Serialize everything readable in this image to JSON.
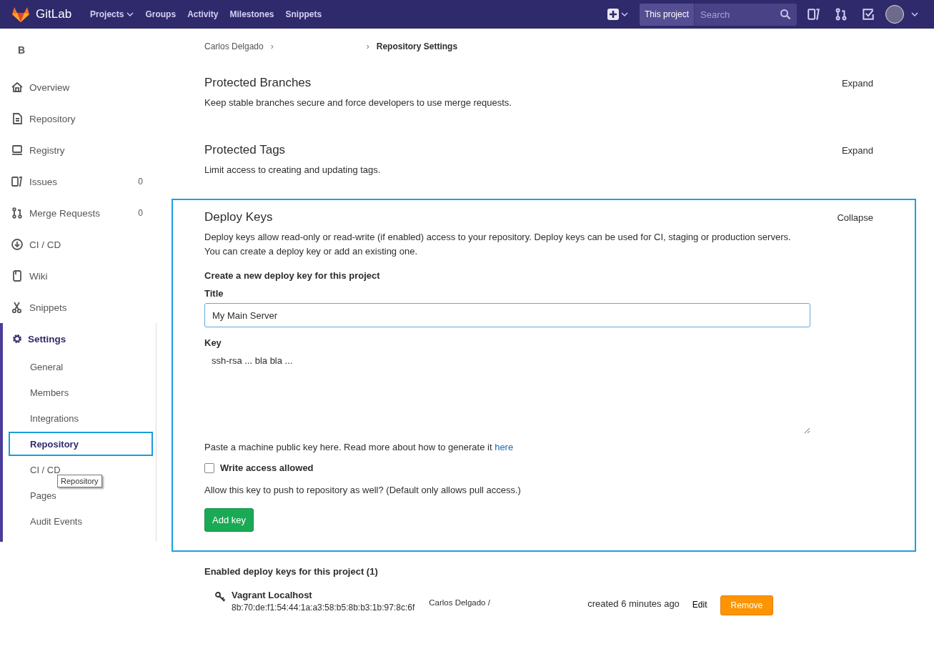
{
  "header": {
    "logo_text": "GitLab",
    "nav": [
      {
        "label": "Projects",
        "has_caret": true
      },
      {
        "label": "Groups",
        "has_caret": false
      },
      {
        "label": "Activity",
        "has_caret": false
      },
      {
        "label": "Milestones",
        "has_caret": false
      },
      {
        "label": "Snippets",
        "has_caret": false
      }
    ],
    "search": {
      "scope": "This project",
      "placeholder": "Search"
    }
  },
  "sidebar": {
    "project_letter": "B",
    "items": [
      {
        "label": "Overview"
      },
      {
        "label": "Repository"
      },
      {
        "label": "Registry"
      },
      {
        "label": "Issues",
        "count": "0"
      },
      {
        "label": "Merge Requests",
        "count": "0"
      },
      {
        "label": "CI / CD"
      },
      {
        "label": "Wiki"
      },
      {
        "label": "Snippets"
      }
    ],
    "settings": {
      "label": "Settings",
      "expanded": true,
      "children": [
        {
          "label": "General",
          "selected": false
        },
        {
          "label": "Members",
          "selected": false
        },
        {
          "label": "Integrations",
          "selected": false
        },
        {
          "label": "Repository",
          "selected": true
        },
        {
          "label": "CI / CD",
          "selected": false
        },
        {
          "label": "Pages",
          "selected": false
        },
        {
          "label": "Audit Events",
          "selected": false
        }
      ]
    },
    "tooltip": "Repository"
  },
  "breadcrumb": {
    "separator": "›",
    "items": [
      "Carlos Delgado",
      "Repository Settings"
    ]
  },
  "sections": [
    {
      "title": "Protected Branches",
      "description": "Keep stable branches secure and force developers to use merge requests.",
      "toggle": "Expand",
      "expanded": false
    },
    {
      "title": "Protected Tags",
      "description": "Limit access to creating and updating tags.",
      "toggle": "Expand",
      "expanded": false
    },
    {
      "title": "Deploy Keys",
      "description": "Deploy keys allow read-only or read-write (if enabled) access to your repository. Deploy keys can be used for CI, staging or production servers. You can create a deploy key or add an existing one.",
      "toggle": "Collapse",
      "expanded": true
    }
  ],
  "deploy_form": {
    "heading": "Create a new deploy key for this project",
    "title_label": "Title",
    "title_value": "My Main Server",
    "key_label": "Key",
    "key_value": "ssh-rsa ... bla bla ...",
    "key_hint": "Paste a machine public key here. Read more about how to generate it",
    "key_hint_link": "here",
    "write_access": {
      "label": "Write access allowed",
      "checked": false
    },
    "write_hint": "Allow this key to push to repository as well? (Default only allows pull access.)",
    "submit": "Add key"
  },
  "enabled_keys": {
    "heading": "Enabled deploy keys for this project (1)",
    "keys": [
      {
        "name": "Vagrant Localhost",
        "fingerprint": "8b:70:de:f1:54:44:1a:a3:58:b5:8b:b3:1b:97:8c:6f",
        "project": "Carlos Delgado /",
        "created": "created 6 minutes ago",
        "edit": "Edit",
        "remove": "Remove"
      }
    ]
  }
}
